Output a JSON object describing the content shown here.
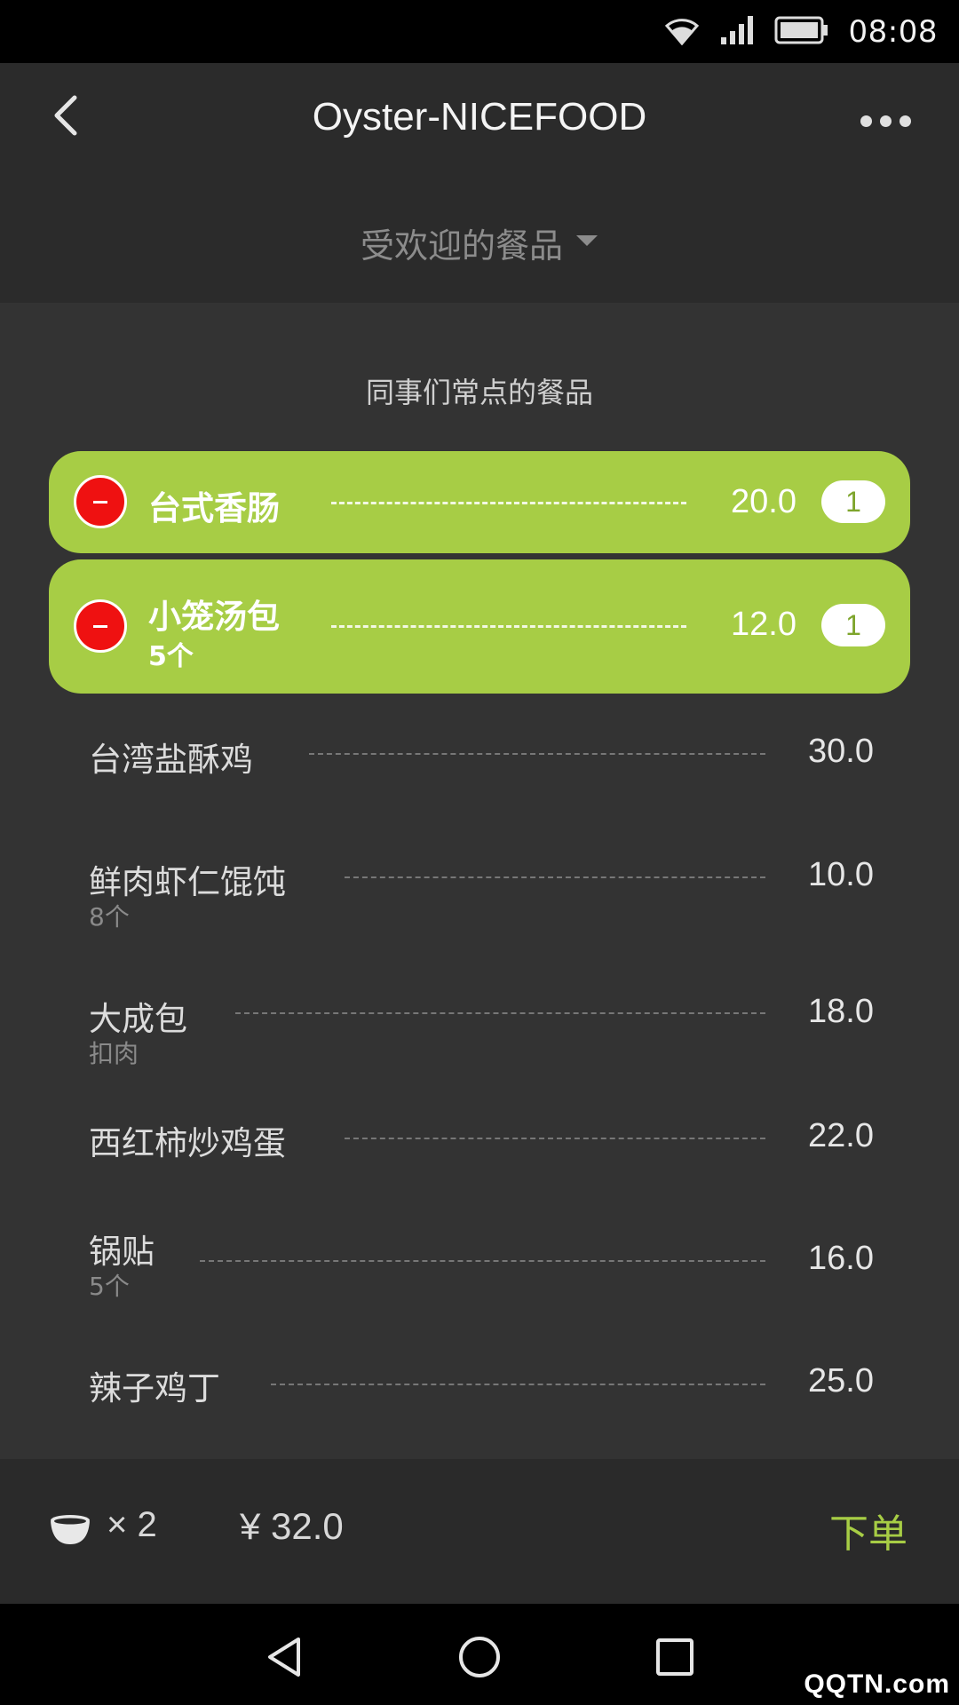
{
  "status_bar": {
    "time": "08:08"
  },
  "header": {
    "title": "Oyster-NICEFOOD",
    "category": "受欢迎的餐品"
  },
  "section_title": "同事们常点的餐品",
  "selected_items": [
    {
      "name": "台式香肠",
      "sub": "",
      "price": "20.0",
      "qty": "1"
    },
    {
      "name": "小笼汤包",
      "sub": "5个",
      "price": "12.0",
      "qty": "1"
    }
  ],
  "menu_items": [
    {
      "name": "台湾盐酥鸡",
      "sub": "",
      "price": "30.0"
    },
    {
      "name": "鲜肉虾仁馄饨",
      "sub": "8个",
      "price": "10.0"
    },
    {
      "name": "大成包",
      "sub": "扣肉",
      "price": "18.0"
    },
    {
      "name": "西红柿炒鸡蛋",
      "sub": "",
      "price": "22.0"
    },
    {
      "name": "锅贴",
      "sub": "5个",
      "price": "16.0"
    },
    {
      "name": "辣子鸡丁",
      "sub": "",
      "price": "25.0"
    }
  ],
  "cart": {
    "count": "× 2",
    "total": "¥ 32.0",
    "order_label": "下单"
  },
  "watermark": "QQTN.com",
  "colors": {
    "accent_green": "#a7cd45",
    "remove_red": "#ef1111",
    "header_bg": "#2b2b2b",
    "content_bg": "#333333"
  },
  "icons": [
    "wifi-icon",
    "signal-icon",
    "battery-icon",
    "back-icon",
    "more-icon",
    "dropdown-arrow-icon",
    "minus-icon",
    "bowl-icon",
    "nav-back-icon",
    "nav-home-icon",
    "nav-recents-icon"
  ]
}
